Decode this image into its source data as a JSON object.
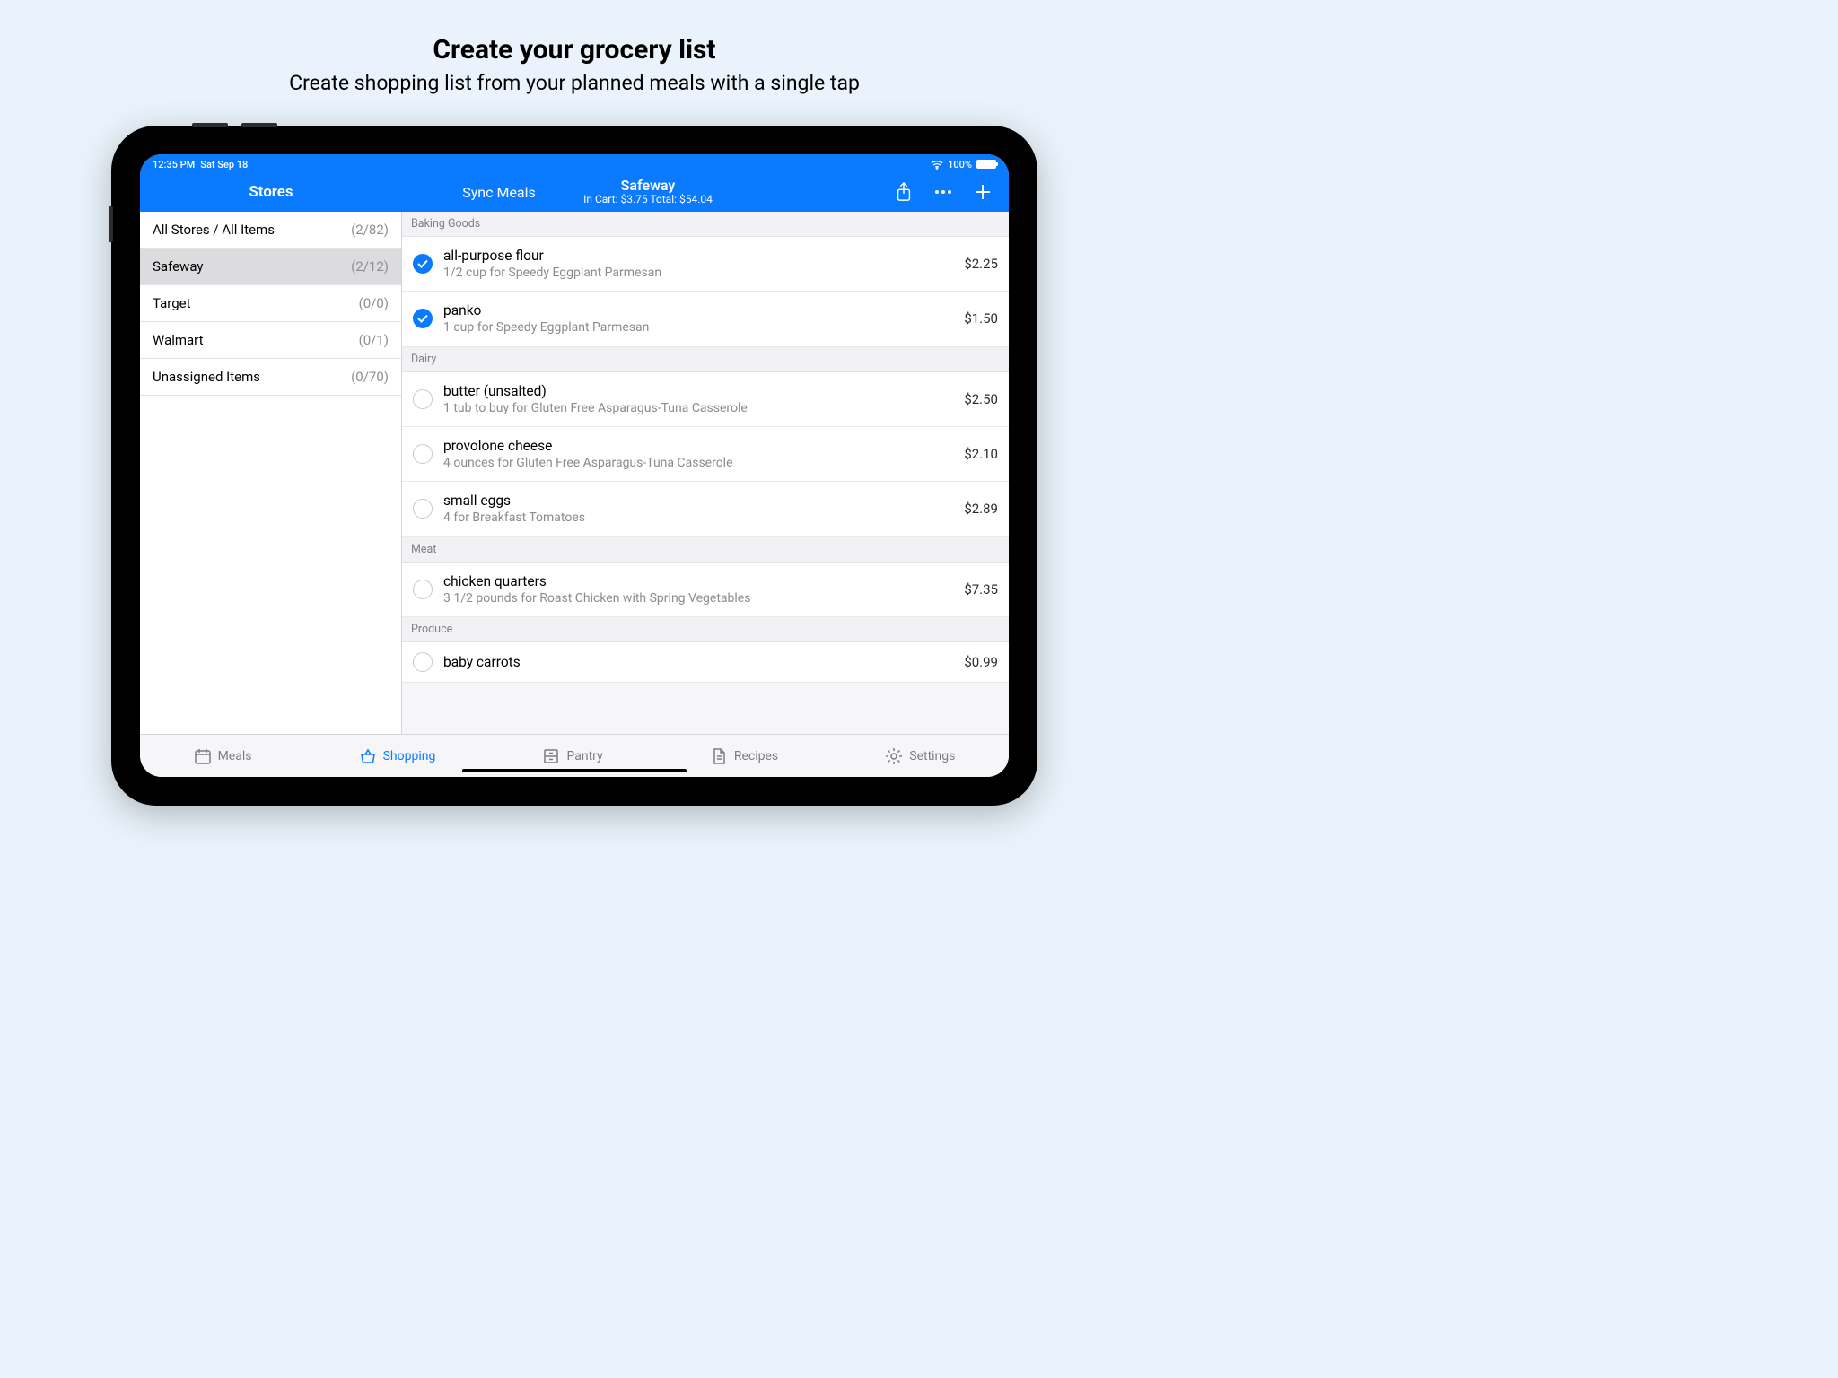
{
  "marketing": {
    "title": "Create your grocery list",
    "subtitle": "Create shopping list from your planned meals with a single tap"
  },
  "status": {
    "time": "12:35 PM",
    "date": "Sat Sep 18",
    "wifi": "wifi-icon",
    "battery_pct": "100%"
  },
  "nav": {
    "stores_title": "Stores",
    "sync_label": "Sync Meals",
    "current_store": "Safeway",
    "totals": "In Cart: $3.75   Total: $54.04",
    "icons": {
      "share": "share-icon",
      "more": "more-icon",
      "add": "plus-icon"
    }
  },
  "sidebar": {
    "stores": [
      {
        "name": "All Stores / All Items",
        "count": "(2/82)",
        "selected": false
      },
      {
        "name": "Safeway",
        "count": "(2/12)",
        "selected": true
      },
      {
        "name": "Target",
        "count": "(0/0)",
        "selected": false
      },
      {
        "name": "Walmart",
        "count": "(0/1)",
        "selected": false
      },
      {
        "name": "Unassigned Items",
        "count": "(0/70)",
        "selected": false
      }
    ]
  },
  "list": {
    "sections": [
      {
        "header": "Baking Goods",
        "items": [
          {
            "checked": true,
            "name": "all-purpose flour",
            "sub": "1/2 cup for Speedy Eggplant Parmesan",
            "price": "$2.25"
          },
          {
            "checked": true,
            "name": "panko",
            "sub": "1 cup for Speedy Eggplant Parmesan",
            "price": "$1.50"
          }
        ]
      },
      {
        "header": "Dairy",
        "items": [
          {
            "checked": false,
            "name": "butter  (unsalted)",
            "sub": "1 tub to buy for Gluten Free Asparagus-Tuna Casserole",
            "price": "$2.50"
          },
          {
            "checked": false,
            "name": "provolone cheese",
            "sub": "4 ounces for Gluten Free Asparagus-Tuna Casserole",
            "price": "$2.10"
          },
          {
            "checked": false,
            "name": "small eggs",
            "sub": "4 for Breakfast Tomatoes",
            "price": "$2.89"
          }
        ]
      },
      {
        "header": "Meat",
        "items": [
          {
            "checked": false,
            "name": "chicken quarters",
            "sub": "3 1/2 pounds for Roast Chicken with Spring Vegetables",
            "price": "$7.35"
          }
        ]
      },
      {
        "header": "Produce",
        "items": [
          {
            "checked": false,
            "name": "baby carrots",
            "sub": "",
            "price": "$0.99"
          }
        ]
      }
    ]
  },
  "tabs": {
    "items": [
      {
        "label": "Meals",
        "icon": "calendar-icon",
        "active": false
      },
      {
        "label": "Shopping",
        "icon": "basket-icon",
        "active": true
      },
      {
        "label": "Pantry",
        "icon": "cabinet-icon",
        "active": false
      },
      {
        "label": "Recipes",
        "icon": "document-icon",
        "active": false
      },
      {
        "label": "Settings",
        "icon": "gear-icon",
        "active": false
      }
    ]
  }
}
